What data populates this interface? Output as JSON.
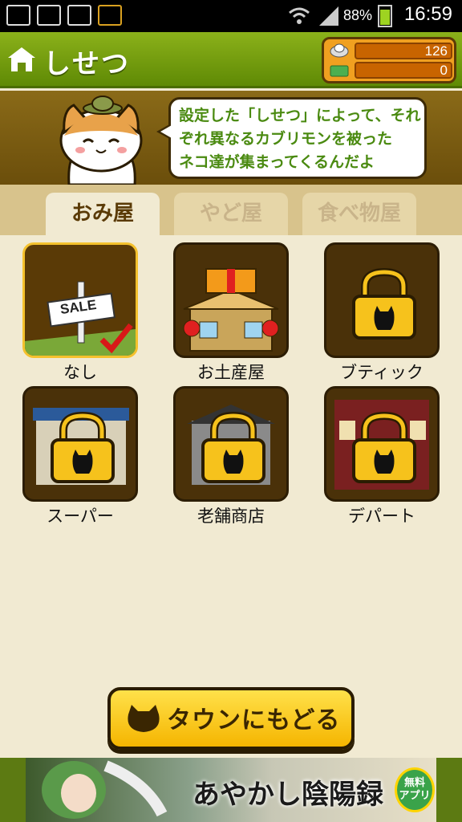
{
  "status_bar": {
    "battery": "88%",
    "time": "16:59"
  },
  "header": {
    "title": "しせつ",
    "coins": "126",
    "tickets": "0"
  },
  "intro": {
    "line1": "設定した「しせつ」によって、それ",
    "line2": "ぞれ異なるカブリモンを被った",
    "line3": "ネコ達が集まってくるんだよ"
  },
  "tabs": [
    "おみ屋",
    "やど屋",
    "食べ物屋"
  ],
  "facilities": [
    {
      "label": "なし",
      "selected": true,
      "locked": false
    },
    {
      "label": "お土産屋",
      "selected": false,
      "locked": false
    },
    {
      "label": "ブティック",
      "selected": false,
      "locked": true
    },
    {
      "label": "スーパー",
      "selected": false,
      "locked": true
    },
    {
      "label": "老舗商店",
      "selected": false,
      "locked": true
    },
    {
      "label": "デパート",
      "selected": false,
      "locked": true
    }
  ],
  "sale_sign": "SALE",
  "back_button": "タウンにもどる",
  "ad": {
    "title": "あやかし陰陽録",
    "badge_line1": "無料",
    "badge_line2": "アプリ"
  },
  "colors": {
    "header_green": "#7da114",
    "accent_yellow": "#f5c518",
    "brown": "#4a3109"
  }
}
